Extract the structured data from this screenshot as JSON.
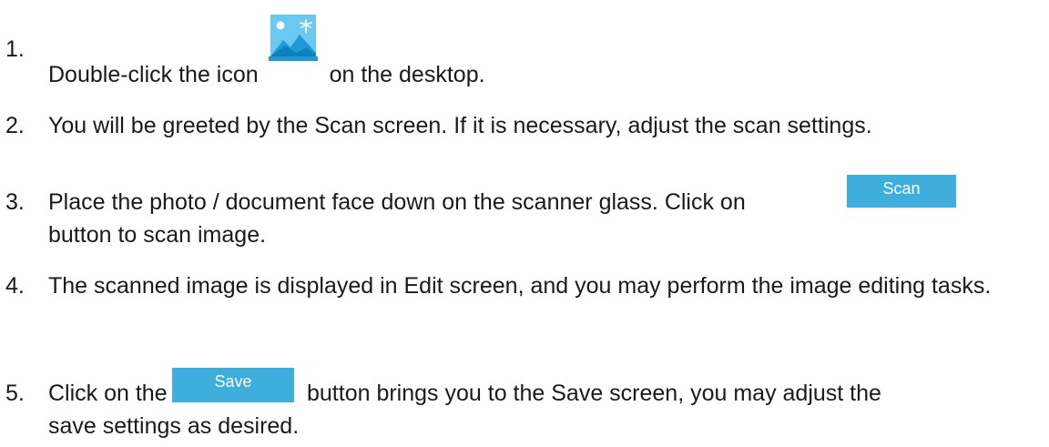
{
  "steps": [
    {
      "number": "1.",
      "before": "Double-click the icon",
      "icon": "photo-app-icon",
      "after": "on the desktop."
    },
    {
      "number": "2.",
      "text": "You will be greeted by the Scan screen. If it is necessary, adjust the scan settings."
    },
    {
      "number": "3.",
      "before": "Place the photo / document face down on the scanner glass. Click on",
      "button_label": "Scan",
      "after": "button to scan image."
    },
    {
      "number": "4.",
      "text": "The scanned image is displayed in Edit screen, and you may perform the image editing tasks."
    },
    {
      "number": "5.",
      "before": "Click on the",
      "button_label": "Save",
      "after": "button brings you to the Save screen, you may adjust the save settings as desired."
    }
  ],
  "colors": {
    "button_bg": "#3eaedc",
    "button_text": "#ffffff",
    "icon_sky": "#5ec4ee",
    "icon_mountain": "#1e9ad6"
  }
}
